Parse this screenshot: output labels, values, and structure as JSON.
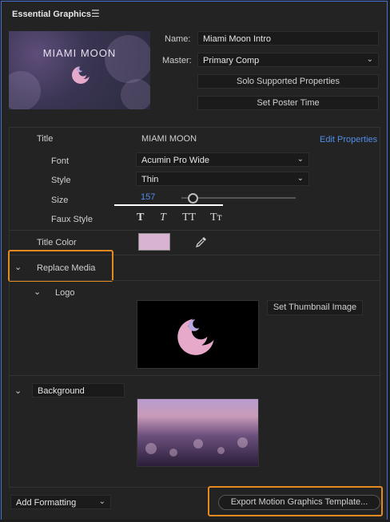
{
  "panel": {
    "title": "Essential Graphics",
    "menu_icon": "hamburger-menu-icon"
  },
  "preview": {
    "text": "MIAMI MOON"
  },
  "meta": {
    "name_label": "Name:",
    "name_value": "Miami Moon Intro",
    "master_label": "Master:",
    "master_value": "Primary Comp",
    "solo_button": "Solo Supported Properties",
    "poster_button": "Set Poster Time"
  },
  "properties": {
    "title_label": "Title",
    "title_value": "MIAMI MOON",
    "edit_link": "Edit Properties",
    "font_label": "Font",
    "font_value": "Acumin Pro Wide",
    "style_label": "Style",
    "style_value": "Thin",
    "size_label": "Size",
    "size_value": "157",
    "faux_label": "Faux Style",
    "faux_buttons": [
      "T",
      "T",
      "TT",
      "Tт"
    ],
    "color_label": "Title Color",
    "title_color": "#d8b4d2"
  },
  "media": {
    "replace_label": "Replace Media",
    "logo_label": "Logo",
    "thumb_button": "Set Thumbnail Image",
    "background_label": "Background"
  },
  "footer": {
    "add_formatting": "Add Formatting",
    "export_button": "Export Motion Graphics Template..."
  },
  "colors": {
    "accent_blue": "#4f8de6",
    "highlight_orange": "#e58a1e"
  }
}
